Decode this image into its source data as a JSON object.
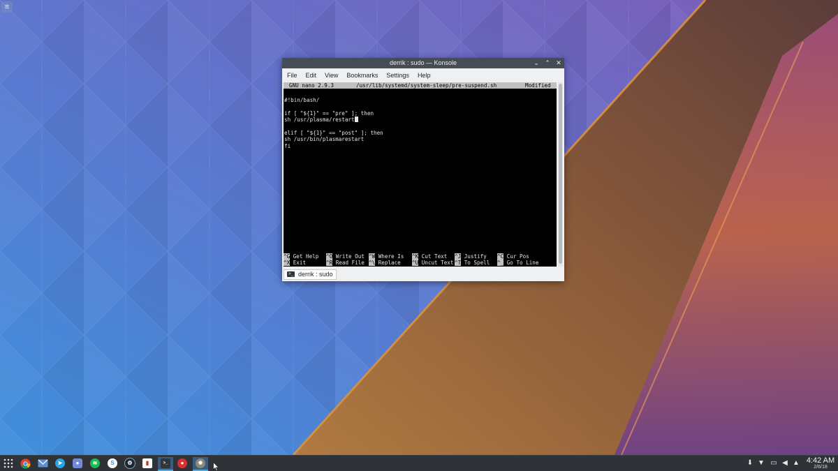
{
  "window": {
    "title": "derrik : sudo — Konsole",
    "controls": {
      "minimize": "⌄",
      "maximize": "⌃",
      "close": "✕"
    },
    "menu": [
      "File",
      "Edit",
      "View",
      "Bookmarks",
      "Settings",
      "Help"
    ],
    "tab_label": "derrik : sudo",
    "tab_icon": "terminal-icon"
  },
  "nano": {
    "version": "GNU nano 2.9.3",
    "file": "/usr/lib/systemd/system-sleep/pre-suspend.sh",
    "status": "Modified",
    "lines": [
      "#!bin/bash/",
      "",
      "if [ \"${1}\" == \"pre\" ]; then",
      "sh /usr/plasma/restart",
      "",
      "elif [ \"${1}\" == \"post\" ]; then",
      "sh /usr/bin/plasmarestart",
      "fi"
    ],
    "shortcuts_row1": [
      {
        "key": "^G",
        "label": "Get Help"
      },
      {
        "key": "^O",
        "label": "Write Out"
      },
      {
        "key": "^W",
        "label": "Where Is"
      },
      {
        "key": "^K",
        "label": "Cut Text"
      },
      {
        "key": "^J",
        "label": "Justify"
      },
      {
        "key": "^C",
        "label": "Cur Pos"
      }
    ],
    "shortcuts_row2": [
      {
        "key": "^X",
        "label": "Exit"
      },
      {
        "key": "^R",
        "label": "Read File"
      },
      {
        "key": "^\\",
        "label": "Replace"
      },
      {
        "key": "^U",
        "label": "Uncut Text"
      },
      {
        "key": "^T",
        "label": "To Spell"
      },
      {
        "key": "^_",
        "label": "Go To Line"
      }
    ]
  },
  "taskbar": {
    "launcher_icon": "app-launcher-icon",
    "apps": [
      {
        "name": "chrome-icon",
        "color": "#e8453c"
      },
      {
        "name": "mail-icon",
        "color": "#5c8fd6"
      },
      {
        "name": "telegram-icon",
        "color": "#2ca5e0"
      },
      {
        "name": "discord-icon",
        "color": "#7289da"
      },
      {
        "name": "spotify-icon",
        "color": "#1db954"
      },
      {
        "name": "simplenote-icon",
        "color": "#3b8fd6"
      },
      {
        "name": "steam-icon",
        "color": "#1b2838"
      },
      {
        "name": "app-red-icon",
        "color": "#c0392b"
      },
      {
        "name": "konsole-icon",
        "color": "#31363b"
      },
      {
        "name": "tomato-icon",
        "color": "#d9312b"
      },
      {
        "name": "gimp-icon",
        "color": "#6e6e5e"
      }
    ],
    "tray": [
      "download-icon",
      "wifi-icon",
      "battery-icon",
      "volume-icon",
      "expand-tray-icon"
    ],
    "clock_time": "4:42 AM",
    "clock_date": "2/6/18"
  },
  "colors": {
    "wallpaper_blue": "#4f86d6",
    "wallpaper_purple": "#8a4ea0",
    "wallpaper_orange": "#c87a3c",
    "taskbar_bg": "#2f3338",
    "accent": "#3daee9"
  }
}
